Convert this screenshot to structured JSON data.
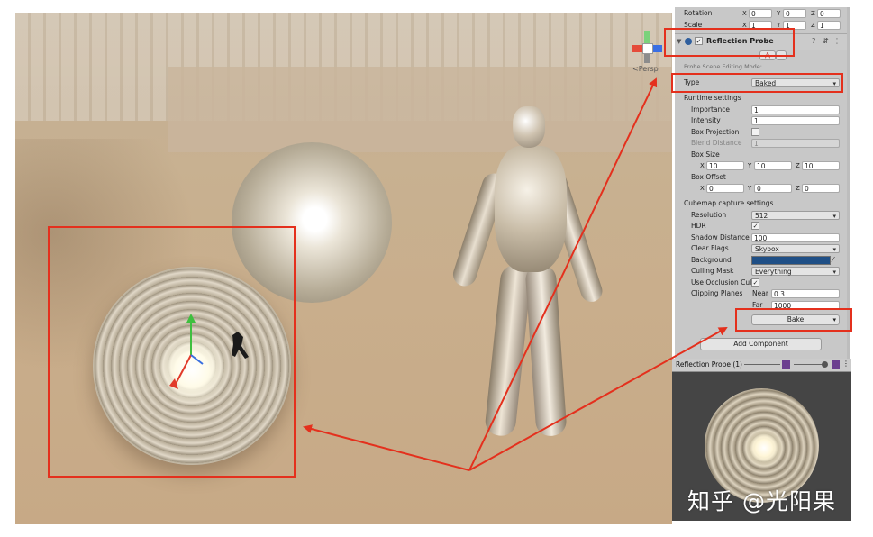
{
  "colors": {
    "annotation": "#e4301d",
    "background_swatch": "#1f4f86",
    "inspector_bg": "#c8c8c8"
  },
  "scene": {
    "persp_label": "<Persp"
  },
  "inspector": {
    "transform": {
      "rotation_label": "Rotation",
      "rotation": {
        "x": "0",
        "y": "0",
        "z": "0"
      },
      "scale_label": "Scale",
      "scale": {
        "x": "1",
        "y": "1",
        "z": "1"
      }
    },
    "component": {
      "title": "Reflection Probe",
      "editing_mode": "Probe Scene Editing Mode:"
    },
    "type_label": "Type",
    "type_value": "Baked",
    "runtime": {
      "header": "Runtime settings",
      "importance_label": "Importance",
      "importance": "1",
      "intensity_label": "Intensity",
      "intensity": "1",
      "box_projection_label": "Box Projection",
      "blend_distance_label": "Blend Distance",
      "blend_distance": "1",
      "box_size_label": "Box Size",
      "box_size": {
        "x": "10",
        "y": "10",
        "z": "10"
      },
      "box_offset_label": "Box Offset",
      "box_offset": {
        "x": "0",
        "y": "0",
        "z": "0"
      }
    },
    "cubemap": {
      "header": "Cubemap capture settings",
      "resolution_label": "Resolution",
      "resolution": "512",
      "hdr_label": "HDR",
      "shadow_distance_label": "Shadow Distance",
      "shadow_distance": "100",
      "clear_flags_label": "Clear Flags",
      "clear_flags": "Skybox",
      "background_label": "Background",
      "culling_mask_label": "Culling Mask",
      "culling_mask": "Everything",
      "occlusion_label": "Use Occlusion Cul",
      "clipping_label": "Clipping Planes",
      "near_label": "Near",
      "near": "0.3",
      "far_label": "Far",
      "far": "1000"
    },
    "bake_label": "Bake",
    "add_component_label": "Add Component",
    "axis": {
      "x": "X",
      "y": "Y",
      "z": "Z"
    },
    "check": "✓"
  },
  "preview": {
    "title": "Reflection Probe (1)"
  },
  "watermark": "知乎 @光阳果"
}
